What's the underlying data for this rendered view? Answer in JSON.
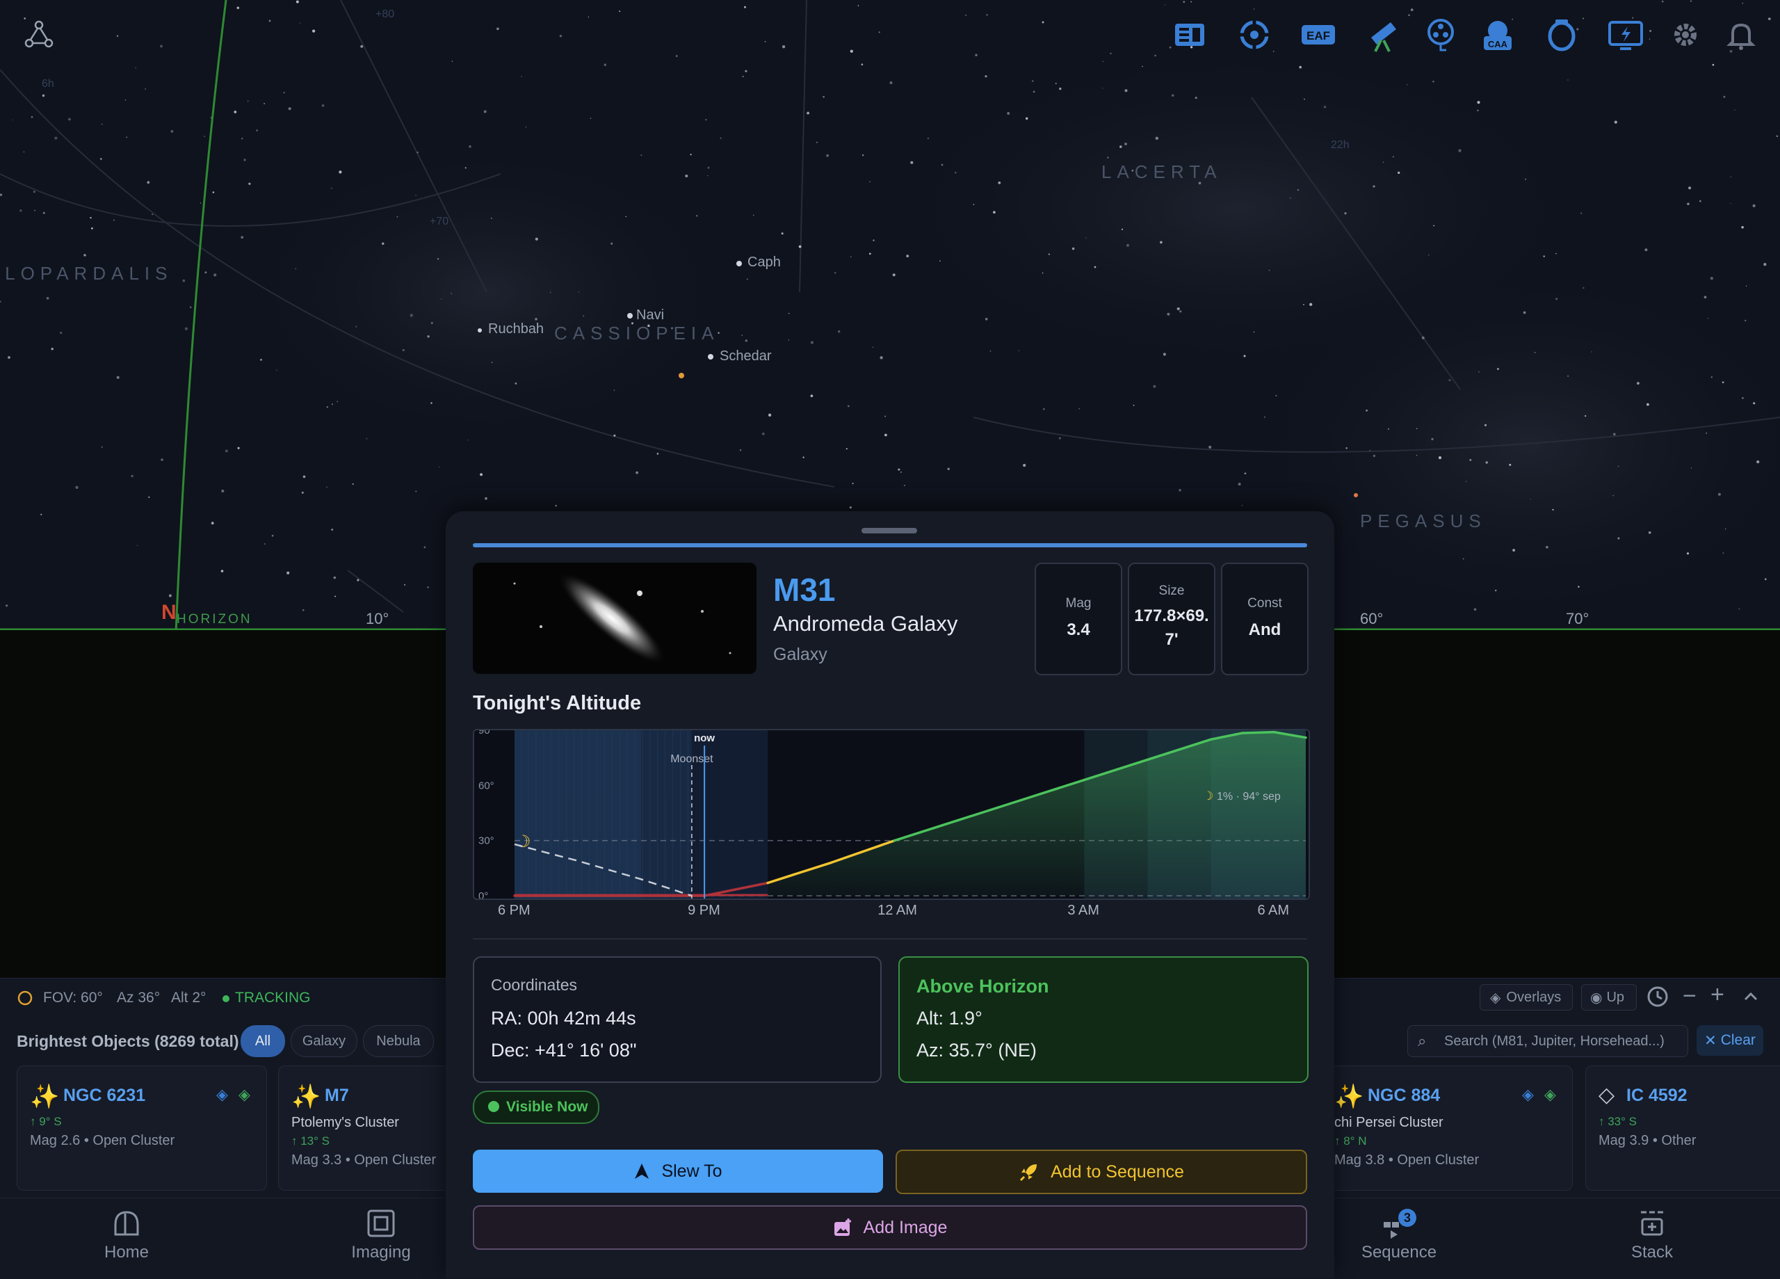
{
  "sky": {
    "stars": [
      {
        "name": "Caph"
      },
      {
        "name": "Navi"
      },
      {
        "name": "Ruchbah"
      },
      {
        "name": "Schedar"
      }
    ],
    "constellations": [
      "LACERTA",
      "CAMELOPARDALIS",
      "CASSIOPEIA",
      "PEGASUS"
    ],
    "horizon_label": "HORIZON",
    "north_marker": "N",
    "az_ticks": [
      "10°",
      "60°",
      "70°"
    ],
    "faint_labels": [
      "+80",
      "6h",
      "22h",
      "+70"
    ]
  },
  "toolbar": {
    "icons": [
      "news-icon",
      "mount-icon",
      "eaf-icon",
      "telescope-icon",
      "filter-wheel-icon",
      "caa-icon",
      "camera-icon",
      "power-box-icon",
      "settings-icon",
      "notifications-icon"
    ],
    "eaf_label": "EAF",
    "caa_label": "CAA"
  },
  "status": {
    "fov": "FOV: 60°",
    "az": "Az 36°",
    "alt": "Alt 2°",
    "tracking": "TRACKING",
    "overlays": "Overlays",
    "up": "Up"
  },
  "browser": {
    "title": "Brightest Objects (8269 total)",
    "filters": [
      "All",
      "Galaxy",
      "Nebula"
    ],
    "search_placeholder": "Search (M81, Jupiter, Horsehead...)",
    "clear": "Clear",
    "cards": [
      {
        "id": "NGC 6231",
        "alt": "↑ 9° S",
        "line": "Mag 2.6 • Open Cluster"
      },
      {
        "id": "M7",
        "name": "Ptolemy's Cluster",
        "alt": "↑ 13° S",
        "line": "Mag 3.3 • Open Cluster"
      },
      {
        "id": "NGC 884",
        "name": "chi Persei Cluster",
        "alt": "↑ 8° N",
        "line": "Mag 3.8 • Open Cluster"
      },
      {
        "id": "IC 4592",
        "alt": "↑ 33° S",
        "line": "Mag 3.9 • Other"
      }
    ]
  },
  "nav": {
    "items": [
      "Home",
      "Imaging",
      "Sequence",
      "Stack"
    ],
    "sequence_badge": "3"
  },
  "panel": {
    "object_id": "M31",
    "object_name": "Andromeda Galaxy",
    "object_type": "Galaxy",
    "stats": [
      {
        "label": "Mag",
        "value": "3.4"
      },
      {
        "label": "Size",
        "value": "177.8×69.7'"
      },
      {
        "label": "Const",
        "value": "And"
      }
    ],
    "altitude_title": "Tonight's Altitude",
    "coordinates": {
      "title": "Coordinates",
      "ra": "RA:  00h 42m 44s",
      "dec": "Dec: +41° 16' 08\""
    },
    "horizon": {
      "title": "Above Horizon",
      "alt": "Alt: 1.9°",
      "az": "Az: 35.7° (NE)"
    },
    "visible_badge": "Visible Now",
    "slew_label": "Slew To",
    "sequence_label": "Add to Sequence",
    "image_label": "Add Image"
  },
  "chart_data": {
    "type": "line",
    "title": "Tonight's Altitude",
    "x_ticks": [
      "6 PM",
      "9 PM",
      "12 AM",
      "3 AM",
      "6 AM"
    ],
    "y_ticks": [
      "0°",
      "30°",
      "60°",
      "90°"
    ],
    "ylim": [
      0,
      90
    ],
    "x_hours": [
      18,
      30.5
    ],
    "now_label": "now",
    "now_hour": 21,
    "moonset_label": "Moonset",
    "moonset_hour": 20.8,
    "moon_note": "1% · 94° sep",
    "series": [
      {
        "x": [
          18.0,
          19.0,
          20.0,
          20.8,
          21.0,
          22.0,
          23.0,
          24.0,
          25.0,
          26.0,
          27.0,
          28.0,
          29.0,
          29.5,
          30.0,
          30.5
        ],
        "y": [
          -18,
          -14,
          -8,
          -3,
          -1,
          7,
          18,
          30,
          41,
          52,
          63,
          74,
          85,
          88.5,
          89,
          86
        ]
      },
      {
        "x": [
          18.0,
          19.0,
          20.0,
          20.8
        ],
        "y": [
          28,
          19,
          9,
          0
        ]
      }
    ]
  }
}
